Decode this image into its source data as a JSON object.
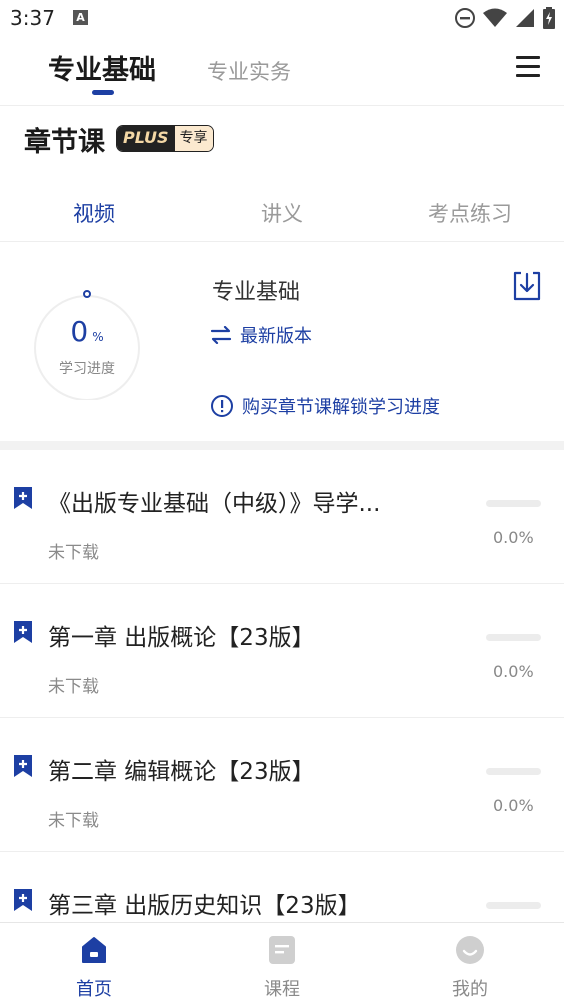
{
  "status_bar": {
    "time": "3:37",
    "notification_letter": "A",
    "icons": [
      "do-not-disturb-icon",
      "wifi-icon",
      "signal-icon",
      "battery-icon"
    ]
  },
  "header": {
    "tabs": [
      {
        "label": "专业基础",
        "active": true
      },
      {
        "label": "专业实务",
        "active": false
      }
    ],
    "menu_icon": "menu-icon"
  },
  "section": {
    "title": "章节课",
    "badge_plus": "PLUS",
    "badge_exclusive": "专享"
  },
  "sub_tabs": [
    {
      "label": "视频",
      "active": true
    },
    {
      "label": "讲义",
      "active": false
    },
    {
      "label": "考点练习",
      "active": false
    }
  ],
  "progress_card": {
    "progress_value": "0",
    "progress_unit": "%",
    "progress_label": "学习进度",
    "course_name": "专业基础",
    "version_label": "最新版本",
    "unlock_notice": "购买章节课解锁学习进度"
  },
  "chapters": [
    {
      "title": "《出版专业基础（中级）》导学...",
      "status": "未下载",
      "progress_text": "0.0%",
      "progress": 0
    },
    {
      "title": "第一章 出版概论【23版】",
      "status": "未下载",
      "progress_text": "0.0%",
      "progress": 0
    },
    {
      "title": "第二章 编辑概论【23版】",
      "status": "未下载",
      "progress_text": "0.0%",
      "progress": 0
    },
    {
      "title": "第三章 出版历史知识【23版】",
      "status": "",
      "progress_text": "",
      "progress": 0
    }
  ],
  "bottom_nav": [
    {
      "label": "首页",
      "icon": "home-icon",
      "active": true
    },
    {
      "label": "课程",
      "icon": "course-icon",
      "active": false
    },
    {
      "label": "我的",
      "icon": "profile-icon",
      "active": false
    }
  ],
  "colors": {
    "accent": "#1d3fa3",
    "muted_text": "#9a9a9a",
    "divider": "#f2f2f2"
  }
}
